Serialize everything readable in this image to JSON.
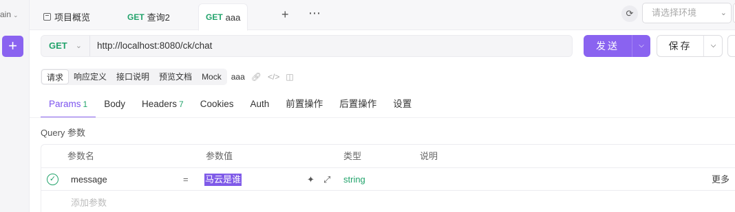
{
  "workspace": {
    "label": "ain"
  },
  "tabs": [
    {
      "label": "项目概览"
    },
    {
      "method": "GET",
      "label": "查询2"
    },
    {
      "method": "GET",
      "label": "aaa"
    }
  ],
  "env": {
    "placeholder": "请选择环境"
  },
  "request": {
    "method": "GET",
    "url": "http://localhost:8080/ck/chat",
    "send_label": "发送",
    "save_label": "保存"
  },
  "modes": {
    "items": [
      "请求",
      "响应定义",
      "接口说明",
      "预览文档",
      "Mock"
    ],
    "name": "aaa"
  },
  "subtabs": [
    {
      "label": "Params",
      "count": "1"
    },
    {
      "label": "Body",
      "count": ""
    },
    {
      "label": "Headers",
      "count": "7"
    },
    {
      "label": "Cookies",
      "count": ""
    },
    {
      "label": "Auth",
      "count": ""
    },
    {
      "label": "前置操作",
      "count": ""
    },
    {
      "label": "后置操作",
      "count": ""
    },
    {
      "label": "设置",
      "count": ""
    }
  ],
  "query": {
    "label": "Query 参数",
    "headers": {
      "name": "参数名",
      "value": "参数值",
      "type": "类型",
      "desc": "说明"
    },
    "rows": [
      {
        "name": "message",
        "eq": "=",
        "value": "马云是谁",
        "type": "string",
        "more": "更多"
      }
    ],
    "add_placeholder": "添加参数"
  },
  "colors": {
    "accent": "#8a63f0",
    "get": "#22a36b"
  },
  "icons": [
    "plus-icon",
    "doc-icon",
    "ellipsis-icon",
    "refresh-icon",
    "chevron-down-icon",
    "link-icon",
    "code-icon",
    "panel-icon",
    "check-circle-icon",
    "magic-wand-icon",
    "expand-icon"
  ]
}
